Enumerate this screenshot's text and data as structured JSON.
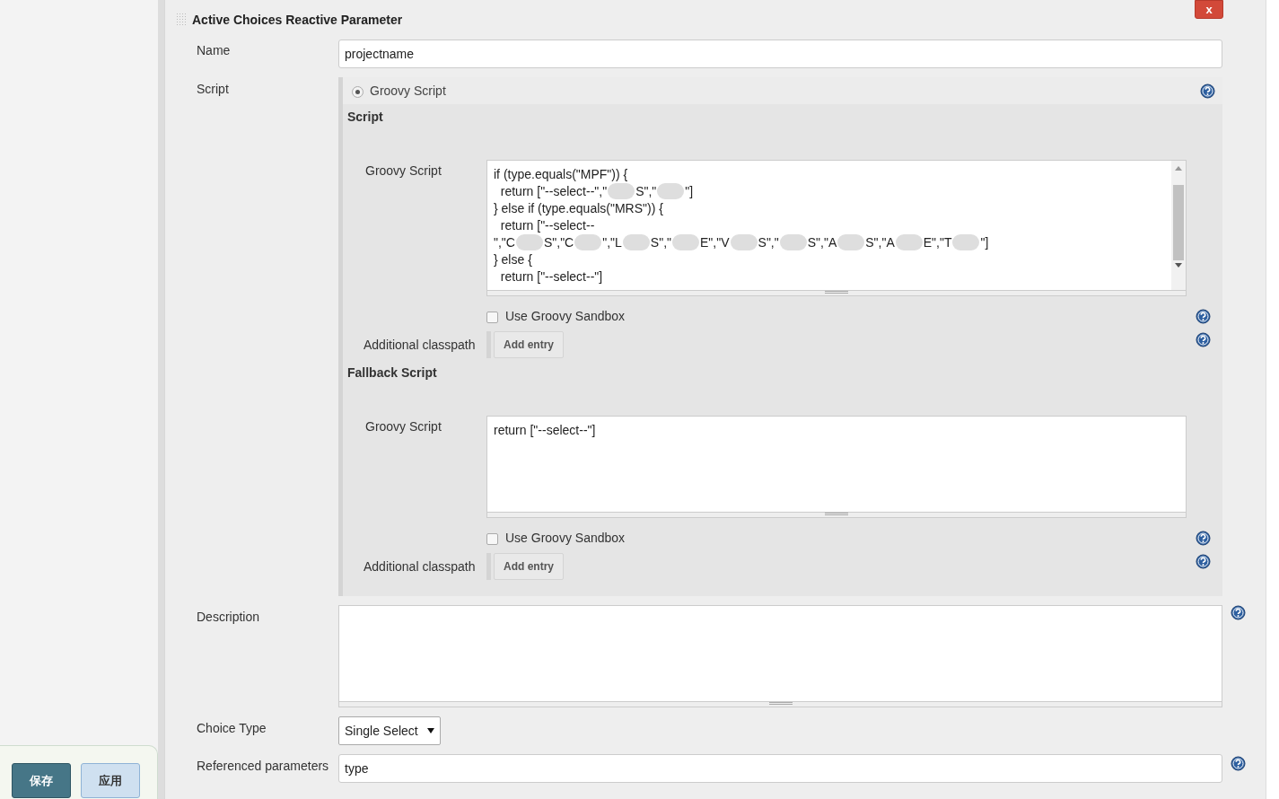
{
  "section": {
    "title": "Active Choices Reactive Parameter",
    "delete_button": "x"
  },
  "name": {
    "label": "Name",
    "value": "projectname"
  },
  "script": {
    "label": "Script",
    "option": {
      "label": "Groovy Script",
      "selected": true
    },
    "blocks": [
      {
        "heading": "Script",
        "field_label": "Groovy Script",
        "scrollbar": true,
        "code": [
          [
            {
              "kind": "text",
              "text": "if (type.equals(\"MPF\")) {"
            }
          ],
          [
            {
              "kind": "text",
              "text": "  return [\"--select--\",\""
            },
            {
              "kind": "blur"
            },
            {
              "kind": "text",
              "text": "S\",\""
            },
            {
              "kind": "blur"
            },
            {
              "kind": "text",
              "text": "\"]"
            }
          ],
          [
            {
              "kind": "text",
              "text": "} else if (type.equals(\"MRS\")) {"
            }
          ],
          [
            {
              "kind": "text",
              "text": "  return [\"--select--"
            }
          ],
          [
            {
              "kind": "text",
              "text": "\",\"C"
            },
            {
              "kind": "blur"
            },
            {
              "kind": "text",
              "text": "S\",\"C"
            },
            {
              "kind": "blur"
            },
            {
              "kind": "text",
              "text": "\",\"L"
            },
            {
              "kind": "blur"
            },
            {
              "kind": "text",
              "text": "S\",\""
            },
            {
              "kind": "blur"
            },
            {
              "kind": "text",
              "text": "E\",\"V"
            },
            {
              "kind": "blur"
            },
            {
              "kind": "text",
              "text": "S\",\""
            },
            {
              "kind": "blur"
            },
            {
              "kind": "text",
              "text": "S\",\"A"
            },
            {
              "kind": "blur"
            },
            {
              "kind": "text",
              "text": "S\",\"A"
            },
            {
              "kind": "blur"
            },
            {
              "kind": "text",
              "text": "E\",\"T"
            },
            {
              "kind": "blur"
            },
            {
              "kind": "text",
              "text": "\"]"
            }
          ],
          [
            {
              "kind": "text",
              "text": "} else {"
            }
          ],
          [
            {
              "kind": "text",
              "text": "  return [\"--select--\"]"
            }
          ]
        ],
        "sandbox": {
          "label": "Use Groovy Sandbox",
          "checked": false
        },
        "classpath": {
          "label": "Additional classpath",
          "button": "Add entry"
        }
      },
      {
        "heading": "Fallback Script",
        "field_label": "Groovy Script",
        "scrollbar": false,
        "code": [
          [
            {
              "kind": "text",
              "text": "return [\"--select--\"]"
            }
          ]
        ],
        "sandbox": {
          "label": "Use Groovy Sandbox",
          "checked": false
        },
        "classpath": {
          "label": "Additional classpath",
          "button": "Add entry"
        }
      }
    ]
  },
  "description": {
    "label": "Description"
  },
  "choice_type": {
    "label": "Choice Type",
    "value": "Single Select"
  },
  "referenced_parameters": {
    "label": "Referenced parameters",
    "value": "type"
  },
  "footer_buttons": [
    {
      "label": "保存",
      "kind": "primary"
    },
    {
      "label": "应用",
      "kind": "secondary"
    }
  ]
}
